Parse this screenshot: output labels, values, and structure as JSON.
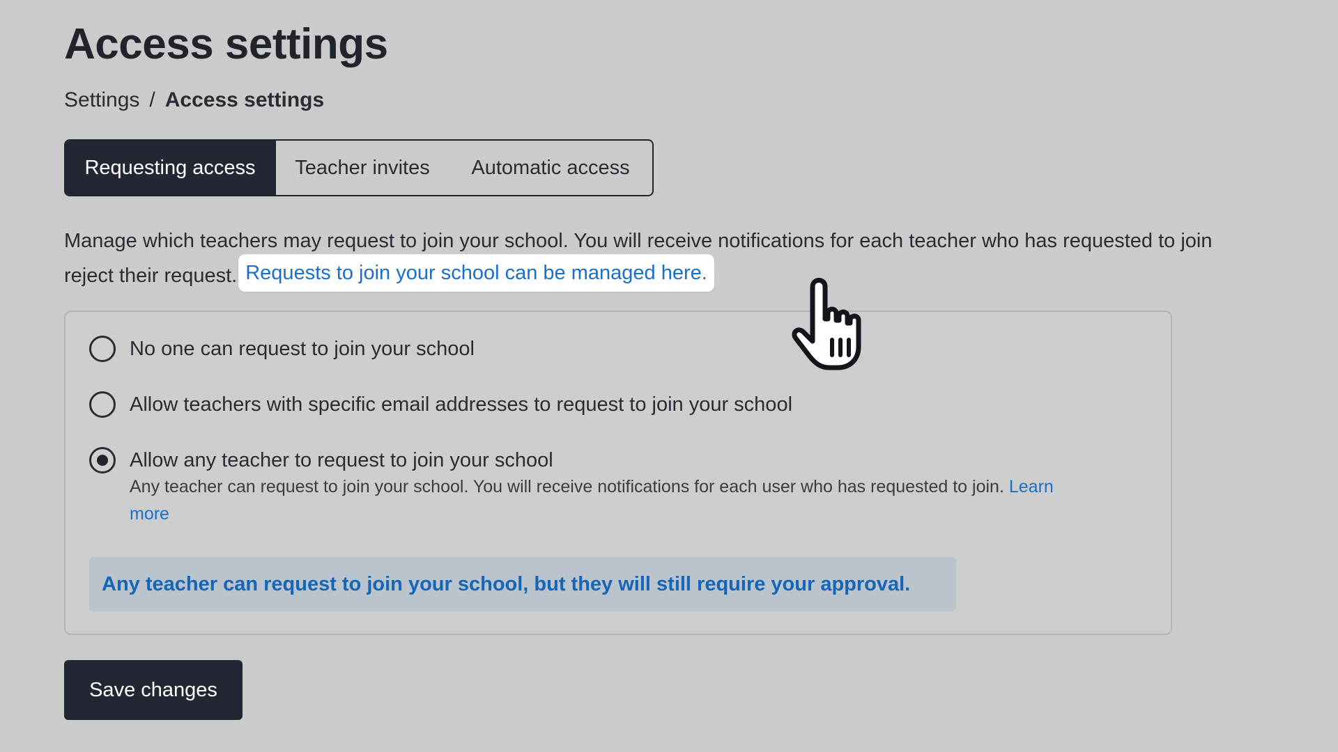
{
  "header": {
    "title": "Access settings"
  },
  "breadcrumb": {
    "parent": "Settings",
    "separator": "/",
    "current": "Access settings"
  },
  "tabs": [
    {
      "label": "Requesting access",
      "active": true
    },
    {
      "label": "Teacher invites",
      "active": false
    },
    {
      "label": "Automatic access",
      "active": false
    }
  ],
  "description": {
    "line1": "Manage which teachers may request to join your school. You will receive notifications for each teacher who has requested to join",
    "line2_prefix": "reject their request.",
    "link": "Requests to join your school can be managed here."
  },
  "options": [
    {
      "label": "No one can request to join your school",
      "selected": false
    },
    {
      "label": "Allow teachers with specific email addresses to request to join your school",
      "selected": false
    },
    {
      "label": "Allow any teacher to request to join your school",
      "selected": true,
      "description": "Any teacher can request to join your school. You will receive notifications for each user who has requested to join.",
      "learn_more": "Learn more"
    }
  ],
  "notice": {
    "text": "Any teacher can request to join your school, but they will still require your approval."
  },
  "actions": {
    "save_label": "Save changes"
  },
  "colors": {
    "background": "#cbcbcb",
    "primary_dark": "#232633",
    "link_blue": "#1a6fc8",
    "notice_bg": "#bac4cc",
    "notice_text": "#1565b8"
  },
  "icons": {
    "cursor": "hand-pointer-icon"
  }
}
